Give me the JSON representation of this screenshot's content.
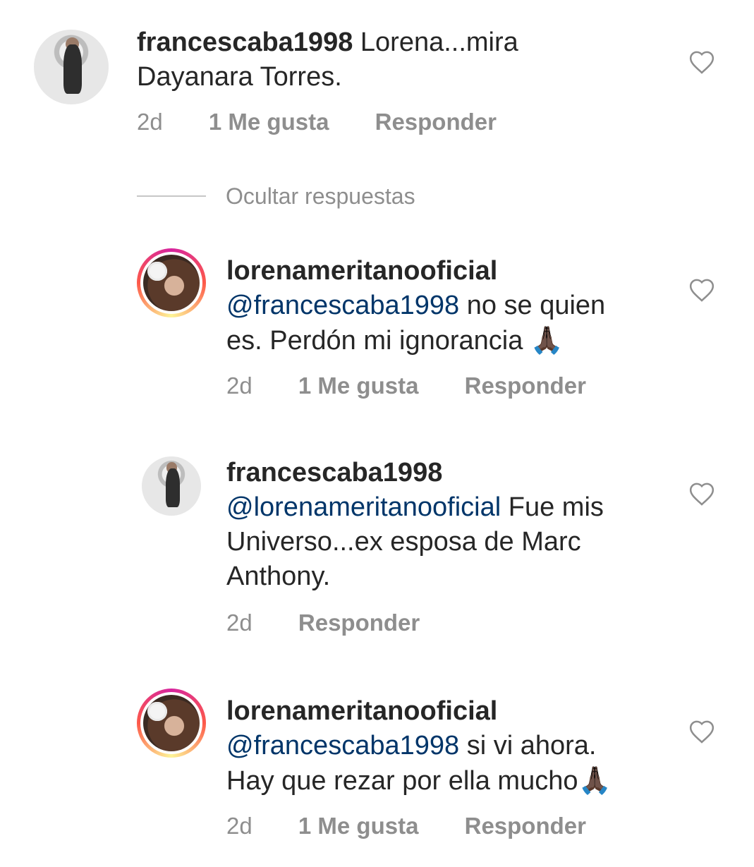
{
  "comments": [
    {
      "username": "francescaba1998",
      "mention": "",
      "text": "Lorena...mira",
      "text2": "Dayanara Torres.",
      "time": "2d",
      "likes": "1 Me gusta",
      "reply": "Responder"
    },
    {
      "username": "lorenameritanooficial",
      "mention": "@francescaba1998",
      "text": "no se quien",
      "text2": "es. Perdón mi ignorancia",
      "emoji": "🙏🏿",
      "time": "2d",
      "likes": "1 Me gusta",
      "reply": "Responder"
    },
    {
      "username": "francescaba1998",
      "mention": "@lorenameritanooficial",
      "text": "Fue mis",
      "text2": "Universo...ex esposa de Marc",
      "text3": "Anthony.",
      "time": "2d",
      "reply": "Responder"
    },
    {
      "username": "lorenameritanooficial",
      "mention": "@francescaba1998",
      "text": "si vi ahora.",
      "text2": "Hay que rezar por ella mucho",
      "emoji": "🙏🏿",
      "time": "2d",
      "likes": "1 Me gusta",
      "reply": "Responder"
    }
  ],
  "hide_replies": "Ocultar respuestas",
  "icons": {
    "heart": "heart-outline-icon"
  },
  "colors": {
    "text": "#262626",
    "meta": "#8e8e8e",
    "mention": "#003569"
  }
}
